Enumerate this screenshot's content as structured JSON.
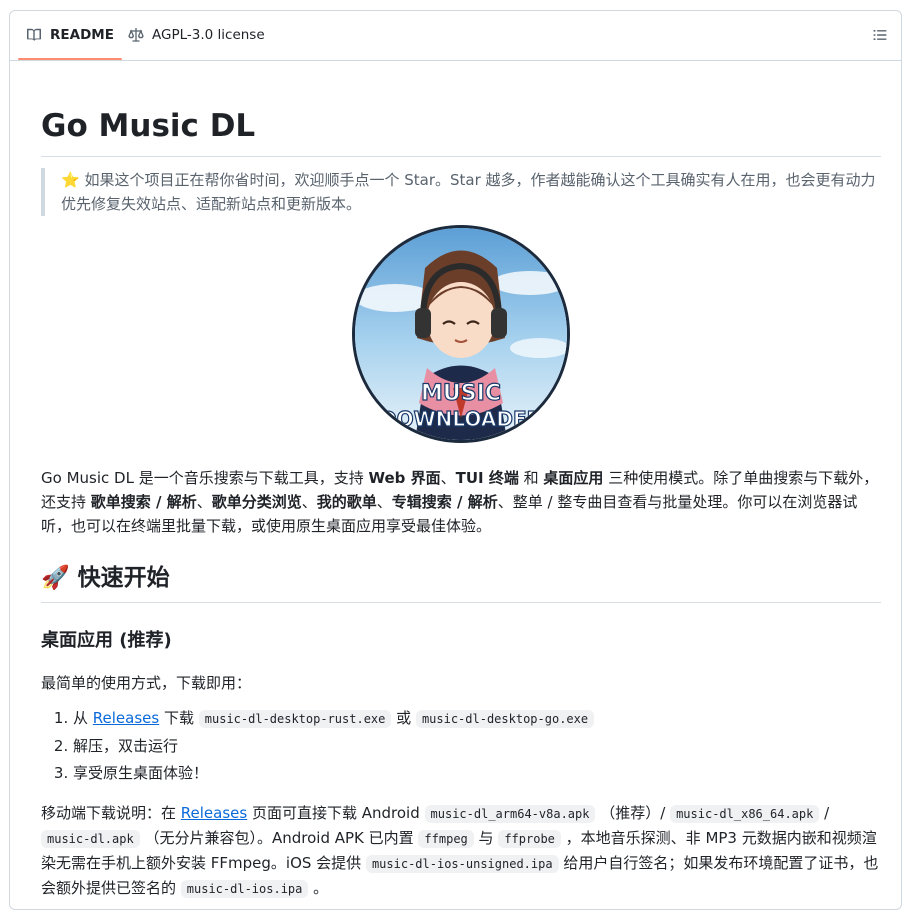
{
  "tabs": {
    "readme": "README",
    "license": "AGPL-3.0 license"
  },
  "article": {
    "title": "Go Music DL",
    "quote": "如果这个项目正在帮你省时间，欢迎顺手点一个 Star。Star 越多，作者越能确认这个工具确实有人在用，也会更有动力优先修复失效站点、适配新站点和更新版本。",
    "quote_emoji": "⭐",
    "logo_line1": "MUSIC",
    "logo_line2": "DOWNLOADER",
    "intro": {
      "t1": "Go Music DL 是一个音乐搜索与下载工具，支持 ",
      "b1": "Web 界面",
      "t2": "、",
      "b2": "TUI 终端",
      "t3": " 和 ",
      "b3": "桌面应用",
      "t4": " 三种使用模式。除了单曲搜索与下载外，还支持 ",
      "b4": "歌单搜索 / 解析",
      "t5": "、",
      "b5": "歌单分类浏览",
      "t6": "、",
      "b6": "我的歌单",
      "t7": "、",
      "b7": "专辑搜索 / 解析",
      "t8": "、整单 / 整专曲目查看与批量处理。你可以在浏览器试听，也可以在终端里批量下载，或使用原生桌面应用享受最佳体验。"
    },
    "quickstart": {
      "emoji": "🚀",
      "heading": "快速开始"
    },
    "desktop": {
      "heading": "桌面应用 (推荐)",
      "lead": "最简单的使用方式，下载即用：",
      "step1_a": "从 ",
      "step1_link": "Releases",
      "step1_b": " 下载 ",
      "step1_code1": "music-dl-desktop-rust.exe",
      "step1_c": " 或 ",
      "step1_code2": "music-dl-desktop-go.exe",
      "step2": "解压，双击运行",
      "step3": "享受原生桌面体验！"
    },
    "mobile": {
      "t1": "移动端下载说明：在 ",
      "link": "Releases",
      "t2": " 页面可直接下载 Android ",
      "c1": "music-dl_arm64-v8a.apk",
      "t3": " （推荐）/ ",
      "c2": "music-dl_x86_64.apk",
      "t4": " / ",
      "c3": "music-dl.apk",
      "t5": " （无分片兼容包）。Android APK 已内置 ",
      "c4": "ffmpeg",
      "t6": " 与 ",
      "c5": "ffprobe",
      "t7": " ，本地音乐探测、非 MP3 元数据内嵌和视频渲染无需在手机上额外安装 FFmpeg。iOS 会提供 ",
      "c6": "music-dl-ios-unsigned.ipa",
      "t8": " 给用户自行签名；如果发布环境配置了证书，也会额外提供已签名的 ",
      "c7": "music-dl-ios.ipa",
      "t9": " 。"
    }
  }
}
